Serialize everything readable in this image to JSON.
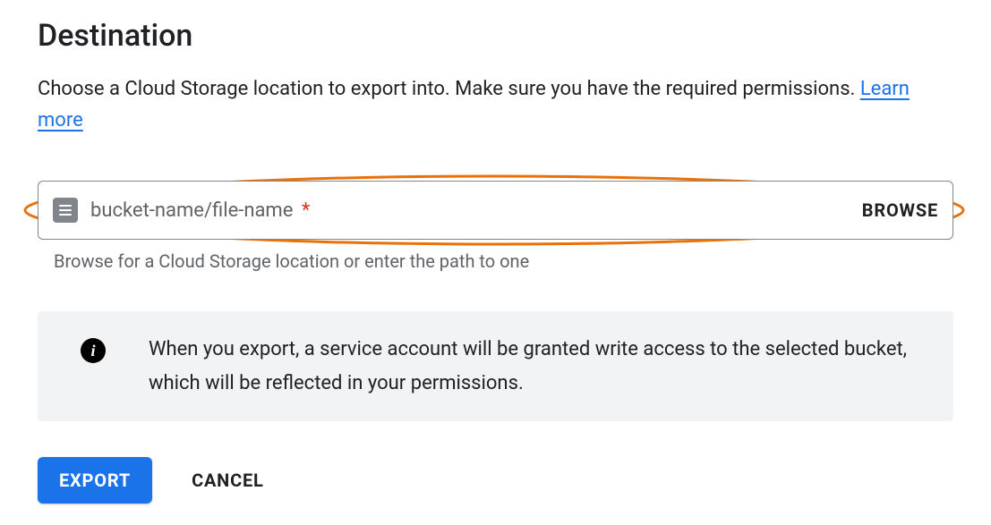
{
  "title": "Destination",
  "description_prefix": "Choose a Cloud Storage location to export into. Make sure you have the required permissions. ",
  "learn_more": "Learn more",
  "input": {
    "placeholder": "bucket-name/file-name",
    "browse": "BROWSE",
    "helper": "Browse for a Cloud Storage location or enter the path to one"
  },
  "info": {
    "text": "When you export, a service account will be granted write access to the selected bucket, which will be reflected in your permissions."
  },
  "actions": {
    "export": "EXPORT",
    "cancel": "CANCEL"
  }
}
